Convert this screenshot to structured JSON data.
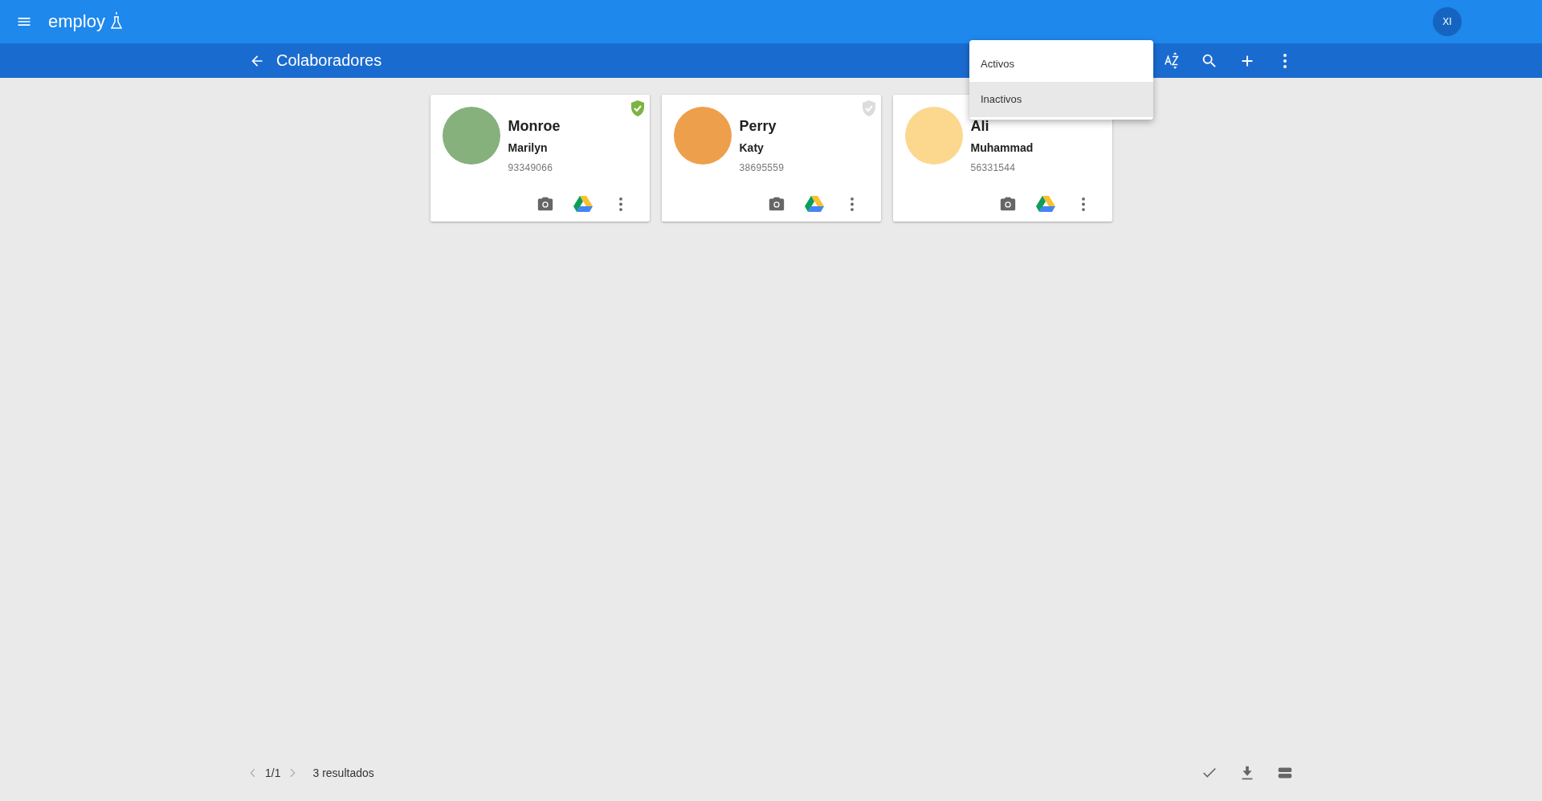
{
  "app_bar": {
    "logo": "employ",
    "avatar_initials": "XI"
  },
  "sub_bar": {
    "title": "Colaboradores",
    "actions": [
      {
        "kind": "sort"
      },
      {
        "kind": "search"
      },
      {
        "kind": "add"
      },
      {
        "kind": "more"
      }
    ]
  },
  "filter_menu": {
    "items": [
      {
        "label": "Activos",
        "selected": false
      },
      {
        "label": "Inactivos",
        "selected": true
      }
    ]
  },
  "cards": [
    {
      "surname": "Monroe",
      "given_name": "Marilyn",
      "number": "93349066",
      "verified": true,
      "color": "#86b07c"
    },
    {
      "surname": "Perry",
      "given_name": "Katy",
      "number": "38695559",
      "verified": false,
      "color": "#ee9f4c"
    },
    {
      "surname": "Ali",
      "given_name": "Muhammad",
      "number": "56331544",
      "color": "#fbd88e"
    }
  ],
  "pager": {
    "page": "1/1",
    "results": "3 resultados",
    "prev_disabled": true,
    "next_disabled": true
  },
  "footer_actions": [
    {
      "kind": "check"
    },
    {
      "kind": "download"
    },
    {
      "kind": "view"
    }
  ]
}
